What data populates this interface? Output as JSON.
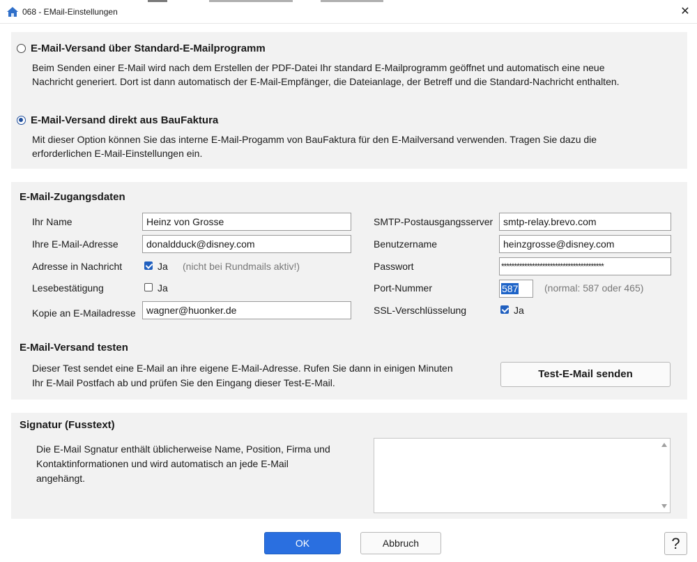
{
  "window": {
    "title": "068  -  EMail-Einstellungen",
    "close_glyph": "✕"
  },
  "mode": {
    "standard": {
      "title": "E-Mail-Versand über Standard-E-Mailprogramm",
      "desc_line1": "Beim Senden einer E-Mail wird nach dem Erstellen der PDF-Datei Ihr standard E-Mailprogramm geöffnet und automatisch eine neue",
      "desc_line2": "Nachricht generiert. Dort ist dann automatisch der E-Mail-Empfänger, die Dateianlage, der Betreff und die Standard-Nachricht enthalten.",
      "selected": false
    },
    "direct": {
      "title": "E-Mail-Versand direkt aus BauFaktura",
      "desc_line1": "Mit dieser Option können Sie das interne E-Mail-Progamm von BauFaktura für den E-Mailversand verwenden. Tragen Sie dazu die",
      "desc_line2": "erforderlichen E-Mail-Einstellungen ein.",
      "selected": true
    }
  },
  "access": {
    "heading": "E-Mail-Zugangsdaten",
    "name_label": "Ihr Name",
    "name_value": "Heinz von Grosse",
    "email_label": "Ihre E-Mail-Adresse",
    "email_value": "donaldduck@disney.com",
    "address_label": "Adresse in Nachricht",
    "address_check_label": "Ja",
    "address_checked": true,
    "address_hint": "(nicht bei Rundmails aktiv!)",
    "read_label": "Lesebestätigung",
    "read_check_label": "Ja",
    "read_checked": false,
    "copy_label": "Kopie an E-Mailadresse",
    "copy_value": "wagner@huonker.de",
    "smtp_label": "SMTP-Postausgangsserver",
    "smtp_value": "smtp-relay.brevo.com",
    "user_label": "Benutzername",
    "user_value": "heinzgrosse@disney.com",
    "password_label": "Passwort",
    "password_value": "****************************************",
    "port_label": "Port-Nummer",
    "port_value": "587",
    "port_hint": "(normal: 587 oder 465)",
    "ssl_label": "SSL-Verschlüsselung",
    "ssl_check_label": "Ja",
    "ssl_checked": true
  },
  "test": {
    "heading": "E-Mail-Versand testen",
    "desc_line1": "Dieser Test sendet eine E-Mail an ihre eigene E-Mail-Adresse. Rufen Sie dann in einigen Minuten",
    "desc_line2": "Ihr E-Mail Postfach ab und prüfen Sie den Eingang dieser Test-E-Mail.",
    "button": "Test-E-Mail senden"
  },
  "signature": {
    "heading": "Signatur (Fusstext)",
    "desc_line1": "Die E-Mail Sgnatur enthält üblicherweise Name, Position, Firma und",
    "desc_line2": "Kontaktinformationen und wird automatisch an jede E-Mail",
    "desc_line3": "angehängt.",
    "value": ""
  },
  "footer": {
    "ok": "OK",
    "cancel": "Abbruch",
    "help": "?"
  },
  "colors": {
    "accent": "#2a6fe0",
    "panel_bg": "#f2f2f2",
    "checkbox_on": "#1f5fbf"
  },
  "icons": {
    "window": "home-icon"
  }
}
